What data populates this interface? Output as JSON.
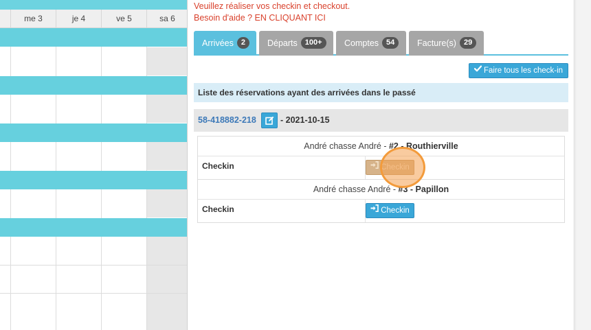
{
  "calendar": {
    "days": [
      "me 3",
      "je 4",
      "ve 5",
      "sa 6"
    ]
  },
  "messages": {
    "line1": "Veuillez réaliser vos checkin et checkout.",
    "line2": "Besoin d'aide ? EN CLIQUANT ICI"
  },
  "tabs": [
    {
      "label": "Arrivées",
      "count": "2"
    },
    {
      "label": "Départs",
      "count": "100+"
    },
    {
      "label": "Comptes",
      "count": "54"
    },
    {
      "label": "Facture(s)",
      "count": "29"
    }
  ],
  "toolbar": {
    "checkall_label": "Faire tous les check-in"
  },
  "section": {
    "title": "Liste des réservations ayant des arrivées dans le passé"
  },
  "reservation": {
    "number": "58-418882-218",
    "date_text": "- 2021-10-15"
  },
  "rooms": [
    {
      "guest": "André chasse André - ",
      "room": "#2 - Routhierville",
      "row_label": "Checkin",
      "button_label": "Checkin"
    },
    {
      "guest": "André chasse André - ",
      "room": "#3 - Papillon",
      "row_label": "Checkin",
      "button_label": "Checkin"
    }
  ],
  "colors": {
    "accent": "#5bc0de",
    "button": "#3aa7d8",
    "alert_text": "#d9412c",
    "calendar_band": "#66d0de",
    "click_highlight": "#f39b3b"
  }
}
